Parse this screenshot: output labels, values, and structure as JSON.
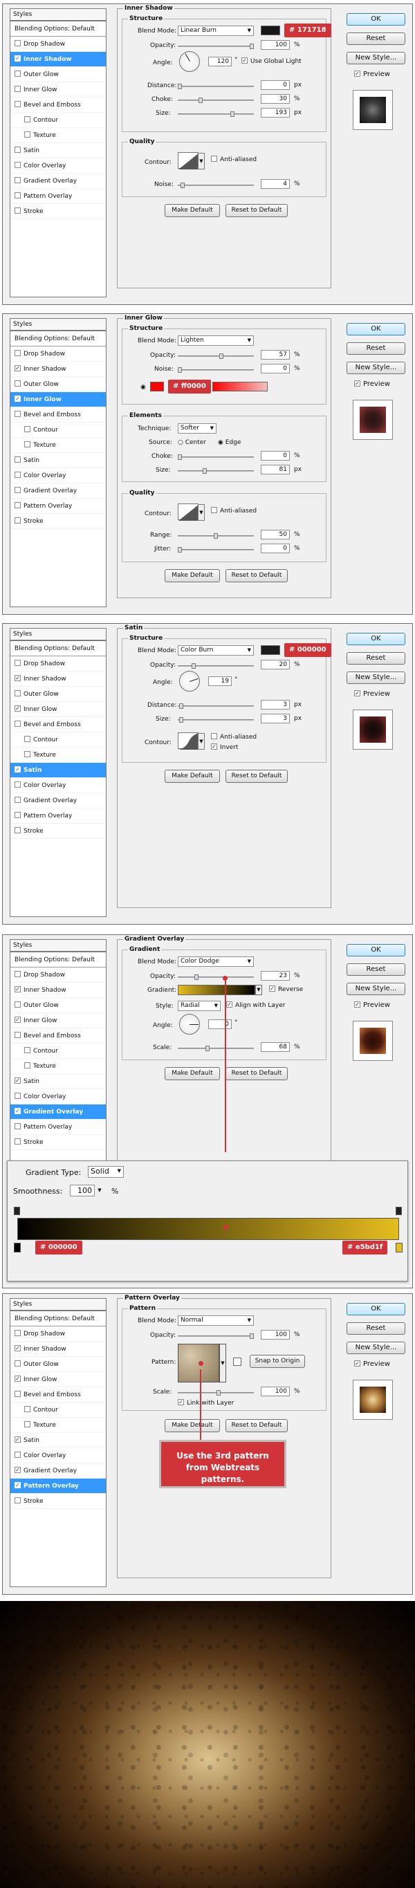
{
  "styles_panel": {
    "header": "Styles",
    "items": [
      "Blending Options: Default",
      "Drop Shadow",
      "Inner Shadow",
      "Outer Glow",
      "Inner Glow",
      "Bevel and Emboss",
      "Contour",
      "Texture",
      "Satin",
      "Color Overlay",
      "Gradient Overlay",
      "Pattern Overlay",
      "Stroke"
    ]
  },
  "buttons": {
    "ok": "OK",
    "reset": "Reset",
    "new_style": "New Style...",
    "preview": "Preview",
    "make_default": "Make Default",
    "reset_default": "Reset to Default"
  },
  "common": {
    "structure": "Structure",
    "quality": "Quality",
    "blend_mode": "Blend Mode:",
    "opacity": "Opacity:",
    "contour": "Contour:",
    "anti_aliased": "Anti-aliased",
    "noise": "Noise:",
    "percent": "%",
    "px": "px",
    "degree": "°"
  },
  "inner_shadow": {
    "title": "Inner Shadow",
    "blend_mode": "Linear Burn",
    "color_label": "# 171718",
    "color": "#171718",
    "opacity": "100",
    "angle": "120",
    "use_global_light": "Use Global Light",
    "distance_label": "Distance:",
    "distance": "0",
    "choke_label": "Choke:",
    "choke": "30",
    "size_label": "Size:",
    "size": "193",
    "noise": "4"
  },
  "inner_glow": {
    "title": "Inner Glow",
    "blend_mode": "Lighten",
    "opacity": "57",
    "noise": "0",
    "color_label": "# ff0000",
    "color": "#ff0000",
    "elements": "Elements",
    "technique_label": "Technique:",
    "technique": "Softer",
    "source_label": "Source:",
    "center": "Center",
    "edge": "Edge",
    "choke_label": "Choke:",
    "choke": "0",
    "size_label": "Size:",
    "size": "81",
    "range_label": "Range:",
    "range": "50",
    "jitter_label": "Jitter:",
    "jitter": "0"
  },
  "satin": {
    "title": "Satin",
    "blend_mode": "Color Burn",
    "color_label": "# 000000",
    "color": "#000000",
    "opacity": "20",
    "angle_label": "Angle:",
    "angle": "19",
    "distance_label": "Distance:",
    "distance": "3",
    "size_label": "Size:",
    "size": "3",
    "invert": "Invert"
  },
  "gradient_overlay": {
    "title": "Gradient Overlay",
    "group": "Gradient",
    "blend_mode": "Color Dodge",
    "opacity": "23",
    "gradient_label": "Gradient:",
    "reverse": "Reverse",
    "style_label": "Style:",
    "style": "Radial",
    "align_with_layer": "Align with Layer",
    "angle_label": "Angle:",
    "angle": "0",
    "scale_label": "Scale:",
    "scale": "68"
  },
  "gradient_editor": {
    "type_label": "Gradient Type:",
    "type": "Solid",
    "smoothness_label": "Smoothness:",
    "smoothness": "100",
    "stop_left_label": "# 000000",
    "stop_left": "#000000",
    "stop_right_label": "# e5bd1f",
    "stop_right": "#e5bd1f"
  },
  "pattern_overlay": {
    "title": "Pattern Overlay",
    "group": "Pattern",
    "blend_mode": "Normal",
    "opacity": "100",
    "pattern_label": "Pattern:",
    "snap_to_origin": "Snap to Origin",
    "scale_label": "Scale:",
    "scale": "100",
    "link_with_layer": "Link with Layer",
    "callout": "Use the 3rd pattern from Webtreats patterns."
  }
}
